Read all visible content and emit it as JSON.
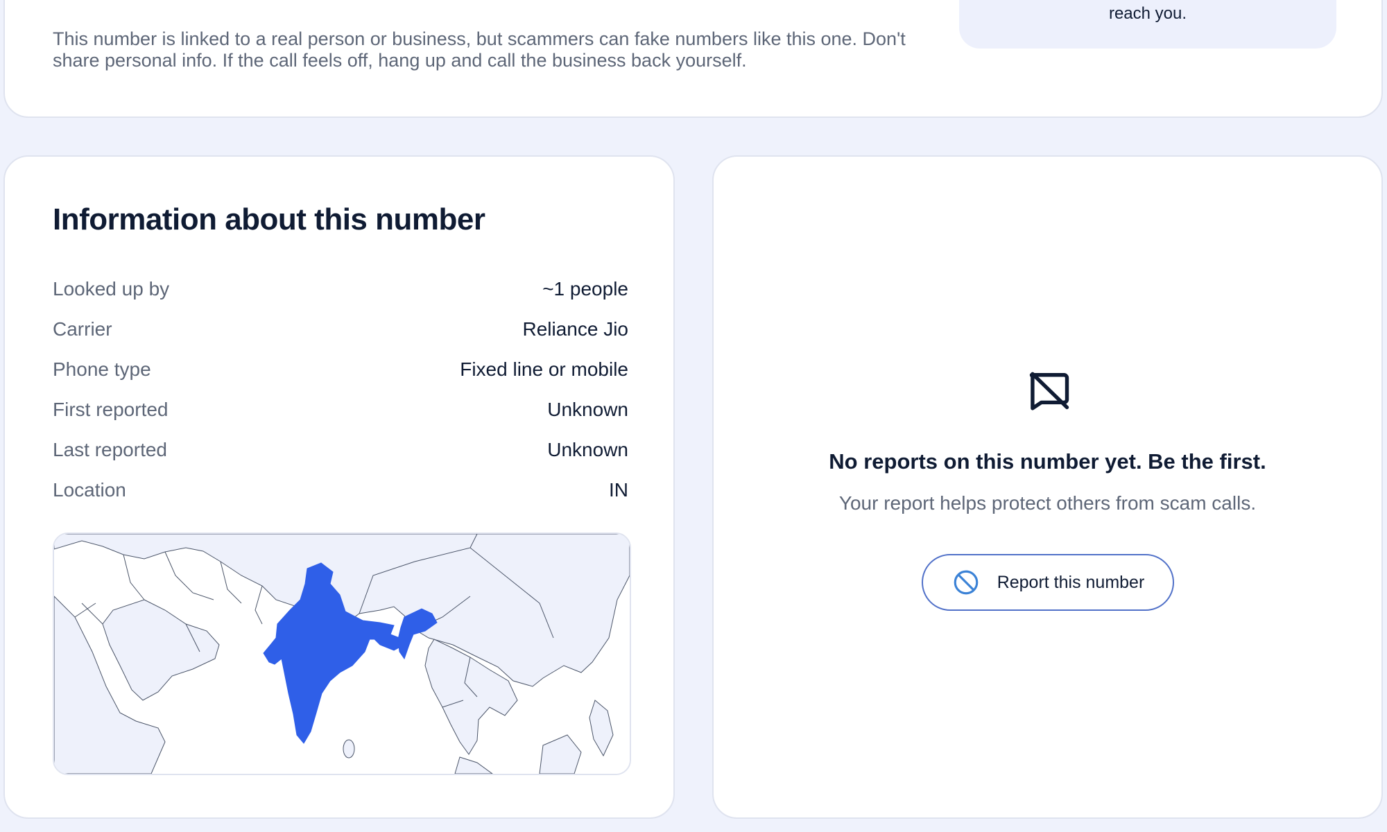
{
  "safety": {
    "note": "This number is linked to a real person or business, but scammers can fake numbers like this one. Don't share personal info. If the call feels off, hang up and call the business back yourself.",
    "callout_tail": "reach you."
  },
  "info": {
    "title": "Information about this number",
    "rows": [
      {
        "label": "Looked up by",
        "value": "~1 people"
      },
      {
        "label": "Carrier",
        "value": "Reliance Jio"
      },
      {
        "label": "Phone type",
        "value": "Fixed line or mobile"
      },
      {
        "label": "First reported",
        "value": "Unknown"
      },
      {
        "label": "Last reported",
        "value": "Unknown"
      },
      {
        "label": "Location",
        "value": "IN"
      }
    ],
    "map": {
      "highlighted_country": "IN",
      "highlight_color": "#2f5fe8",
      "land_color": "#eef1fb",
      "sea_color": "#ffffff"
    }
  },
  "reports": {
    "icon": "message-off-icon",
    "empty_title": "No reports on this number yet. Be the first.",
    "empty_subtitle": "Your report helps protect others from scam calls.",
    "report_button": {
      "label": "Report this number",
      "icon": "ban-icon",
      "icon_color": "#3b82d6"
    }
  }
}
